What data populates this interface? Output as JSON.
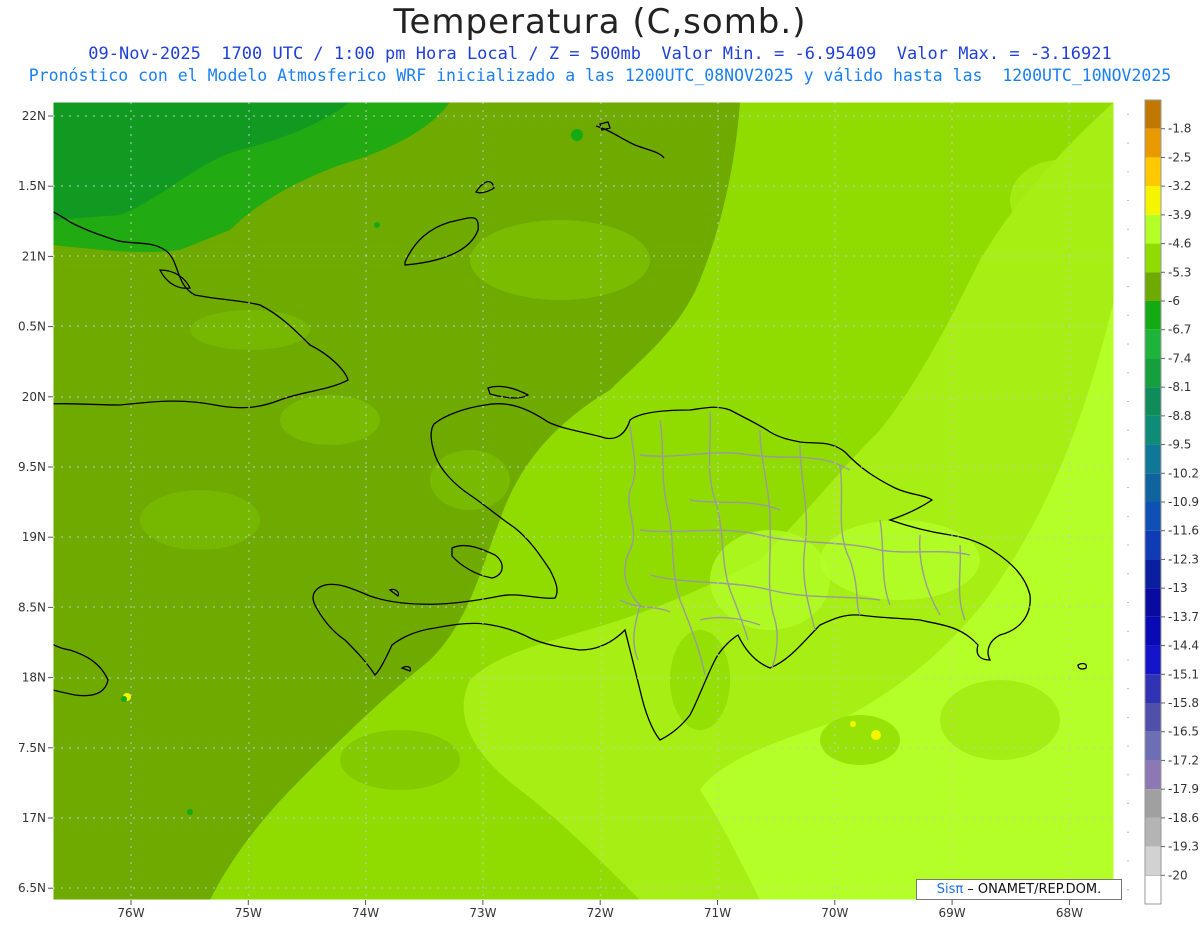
{
  "title": "Temperatura (C,somb.)",
  "subtitle_line1": "09-Nov-2025  1700 UTC / 1:00 pm Hora Local / Z = 500mb  Valor Min. = -6.95409  Valor Max. = -3.16921",
  "subtitle_line2": "Pronóstico con el Modelo Atmosferico WRF inicializado a las 1200UTC_08NOV2025 y válido hasta las  1200UTC_10NOV2025",
  "credit": {
    "brand": "Sisπ",
    "text": "– ONAMET/REP.DOM."
  },
  "lat_labels": [
    "22N",
    "1.5N",
    "21N",
    "0.5N",
    "20N",
    "9.5N",
    "19N",
    "8.5N",
    "18N",
    "7.5N",
    "17N",
    "6.5N"
  ],
  "lon_labels": [
    "76W",
    "75W",
    "74W",
    "73W",
    "72W",
    "71W",
    "70W",
    "69W",
    "68W"
  ],
  "colorbar": {
    "labels": [
      "-1.8",
      "-2.5",
      "-3.2",
      "-3.9",
      "-4.6",
      "-5.3",
      "-6",
      "-6.7",
      "-7.4",
      "-8.1",
      "-8.8",
      "-9.5",
      "-10.2",
      "-10.9",
      "-11.6",
      "-12.3",
      "-13",
      "-13.7",
      "-14.4",
      "-15.1",
      "-15.8",
      "-16.5",
      "-17.2",
      "-17.9",
      "-18.6",
      "-19.3",
      "-20"
    ],
    "colors": [
      "#c07800",
      "#e89a00",
      "#ffc800",
      "#f5f500",
      "#b4ff28",
      "#90dc00",
      "#6eaa00",
      "#14aa14",
      "#1eb43c",
      "#14a03c",
      "#0f8c5a",
      "#0f8c78",
      "#0f7896",
      "#0f64a0",
      "#0f50b4",
      "#0f3cb4",
      "#0a1ea0",
      "#0a0aa0",
      "#0a0ab4",
      "#1414c8",
      "#3232b4",
      "#5050aa",
      "#6e6eb4",
      "#8c78b4",
      "#a0a0a0",
      "#b4b4b4",
      "#d2d2d2"
    ]
  },
  "field": {
    "variable": "Temperatura 500mb",
    "units": "C",
    "min": -6.95409,
    "max": -3.16921
  }
}
